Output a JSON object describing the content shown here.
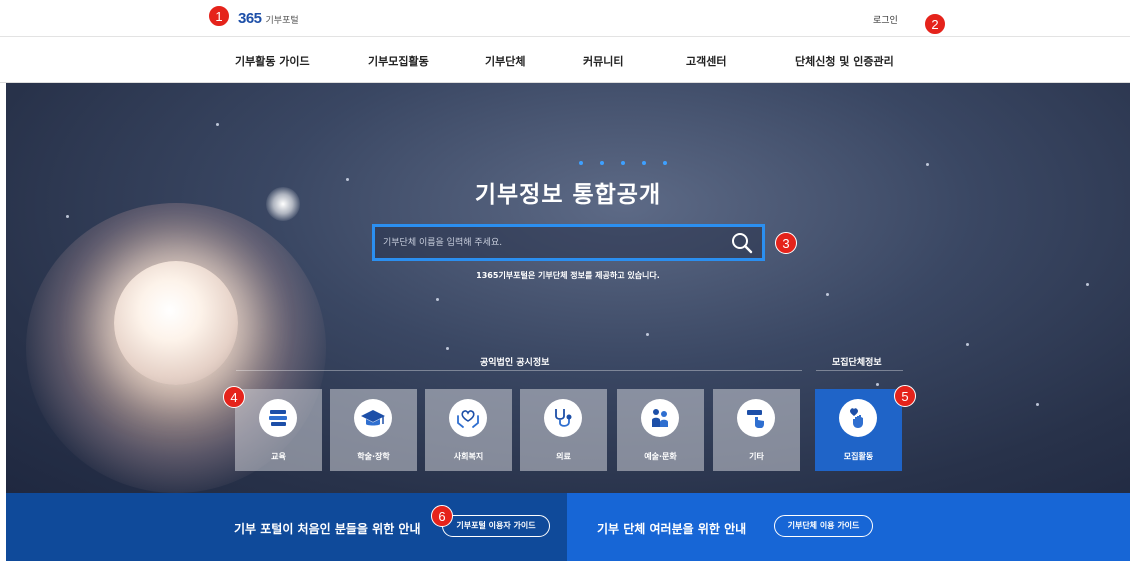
{
  "header": {
    "logo_number": "365",
    "logo_text": "기부포털",
    "login_label": "로그인"
  },
  "nav": {
    "items": [
      "기부활동 가이드",
      "기부모집활동",
      "기부단체",
      "커뮤니티",
      "고객센터",
      "단체신청 및 인증관리"
    ]
  },
  "hero": {
    "title": "기부정보 통합공개",
    "search": {
      "placeholder": "기부단체 이름을 입력해 주세요.",
      "icon": "search-icon"
    },
    "subtitle": "1365기부포털은 기부단체 정보를 제공하고 있습니다.",
    "section_public": "공익법인 공시정보",
    "section_recruit": "모집단체정보",
    "categories": [
      {
        "label": "교육",
        "icon": "books-icon"
      },
      {
        "label": "학술·장학",
        "icon": "graduation-cap-icon"
      },
      {
        "label": "사회복지",
        "icon": "heart-hands-icon"
      },
      {
        "label": "의료",
        "icon": "stethoscope-icon"
      },
      {
        "label": "예술·문화",
        "icon": "people-icon"
      },
      {
        "label": "기타",
        "icon": "hand-pointer-icon"
      }
    ],
    "recruit_tile": {
      "label": "모집활동",
      "icon": "heart-hand-icon"
    }
  },
  "banner": {
    "left_text": "기부 포털이 처음인 분들을 위한 안내",
    "left_button": "기부포털 이용자 가이드",
    "right_text": "기부 단체 여러분을 위한 안내",
    "right_button": "기부단체 이용 가이드"
  },
  "markers": [
    "1",
    "2",
    "3",
    "4",
    "5",
    "6"
  ],
  "colors": {
    "accent": "#2b8ff0",
    "brand_blue": "#1d4fa8",
    "marker_red": "#e5231b",
    "band_dark": "#0f4a9a",
    "band_light": "#1766d6"
  }
}
